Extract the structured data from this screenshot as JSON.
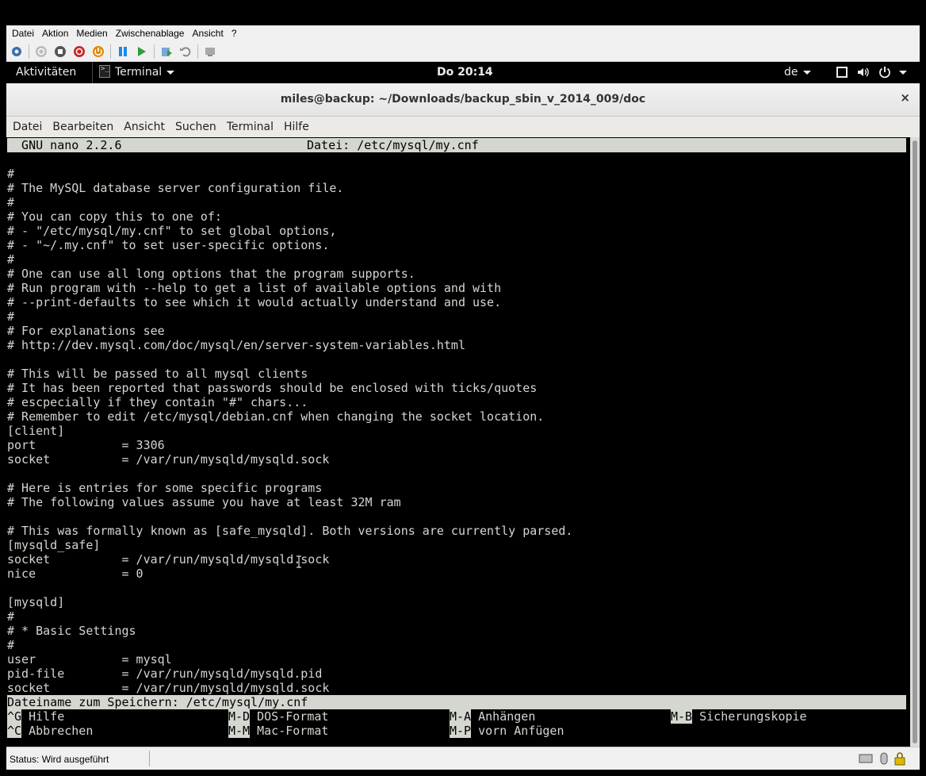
{
  "host": {
    "menu": [
      "Datei",
      "Aktion",
      "Medien",
      "Zwischenablage",
      "Ansicht",
      "?"
    ],
    "toolbar": [
      {
        "name": "settings-icon",
        "color": "#3a6ea5"
      },
      {
        "name": "power-off-gray-icon",
        "color": "#9c9c9c"
      },
      {
        "name": "stop-icon",
        "color": "#555555"
      },
      {
        "name": "shutdown-icon",
        "color": "#c62828"
      },
      {
        "name": "power-icon",
        "color": "#e08a00"
      },
      {
        "name": "pause-icon",
        "color": "#1e88e5"
      },
      {
        "name": "play-icon",
        "color": "#2e9e3e"
      },
      {
        "name": "checkpoint-icon",
        "color": "#2e9e3e"
      },
      {
        "name": "revert-icon",
        "color": "#8a8a8a"
      },
      {
        "name": "enhanced-session-icon",
        "color": "#8a8a8a"
      }
    ],
    "status": "Status: Wird ausgeführt"
  },
  "gnome": {
    "activities": "Aktivitäten",
    "app": "Terminal",
    "clock": "Do 20:14",
    "lang": "de"
  },
  "window": {
    "title": "miles@backup: ~/Downloads/backup_sbin_v_2014_009/doc",
    "close": "×",
    "menu": [
      "Datei",
      "Bearbeiten",
      "Ansicht",
      "Suchen",
      "Terminal",
      "Hilfe"
    ]
  },
  "nano": {
    "header_left": "  GNU nano 2.2.6",
    "header_file": "Datei: /etc/mysql/my.cnf",
    "lines": [
      "",
      "#",
      "# The MySQL database server configuration file.",
      "#",
      "# You can copy this to one of:",
      "# - \"/etc/mysql/my.cnf\" to set global options,",
      "# - \"~/.my.cnf\" to set user-specific options.",
      "#",
      "# One can use all long options that the program supports.",
      "# Run program with --help to get a list of available options and with",
      "# --print-defaults to see which it would actually understand and use.",
      "#",
      "# For explanations see",
      "# http://dev.mysql.com/doc/mysql/en/server-system-variables.html",
      "",
      "# This will be passed to all mysql clients",
      "# It has been reported that passwords should be enclosed with ticks/quotes",
      "# escpecially if they contain \"#\" chars...",
      "# Remember to edit /etc/mysql/debian.cnf when changing the socket location.",
      "[client]",
      "port            = 3306",
      "socket          = /var/run/mysqld/mysqld.sock",
      "",
      "# Here is entries for some specific programs",
      "# The following values assume you have at least 32M ram",
      "",
      "# This was formally known as [safe_mysqld]. Both versions are currently parsed.",
      "[mysqld_safe]",
      "socket          = /var/run/mysqld/mysqld.sock",
      "nice            = 0",
      "",
      "[mysqld]",
      "#",
      "# * Basic Settings",
      "#",
      "user            = mysql",
      "pid-file        = /var/run/mysqld/mysqld.pid",
      "socket          = /var/run/mysqld/mysqld.sock"
    ],
    "prompt": "Dateiname zum Speichern: /etc/mysql/my.cnf",
    "shortcuts_row1": [
      {
        "key": "^G",
        "label": " Hilfe"
      },
      {
        "key": "M-D",
        "label": " DOS-Format"
      },
      {
        "key": "M-A",
        "label": " Anhängen"
      },
      {
        "key": "M-B",
        "label": " Sicherungskopie"
      }
    ],
    "shortcuts_row2": [
      {
        "key": "^C",
        "label": " Abbrechen"
      },
      {
        "key": "M-M",
        "label": " Mac-Format"
      },
      {
        "key": "M-P",
        "label": " vorn Anfügen"
      }
    ]
  }
}
